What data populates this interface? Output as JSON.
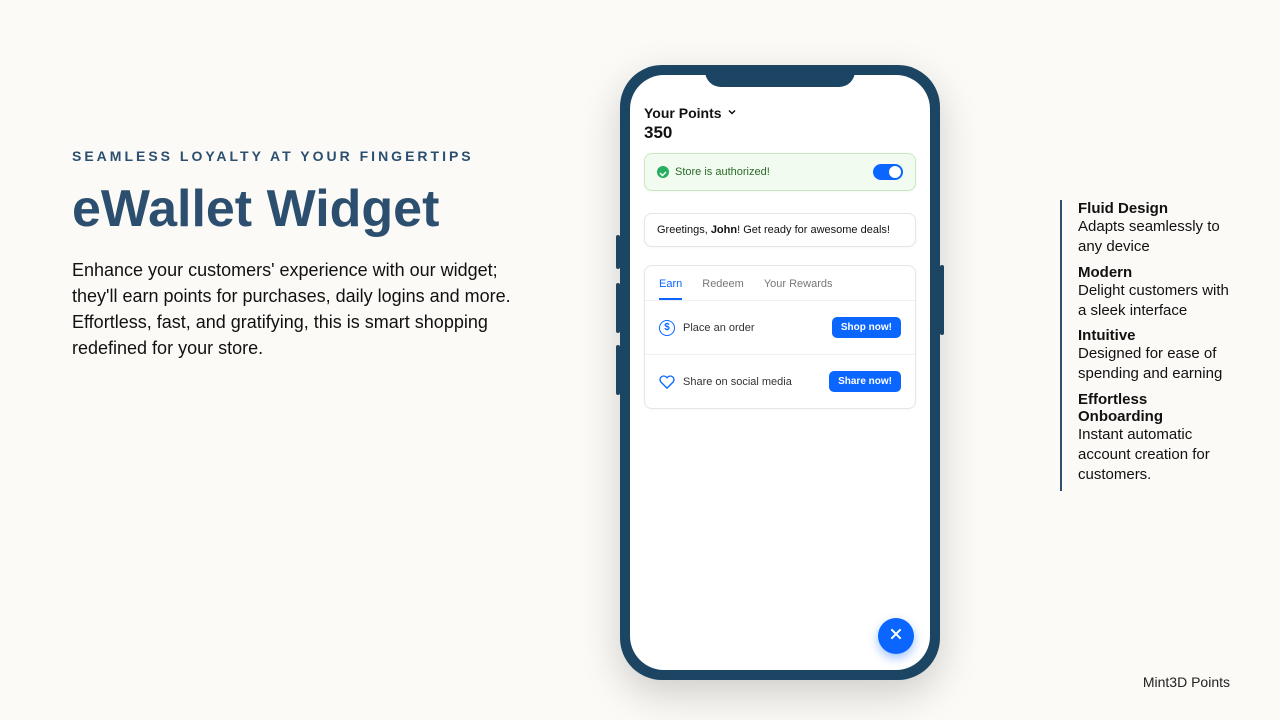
{
  "left": {
    "eyebrow": "SEAMLESS LOYALTY AT YOUR FINGERTIPS",
    "title": "eWallet Widget",
    "desc": "Enhance your customers' experience with our widget; they'll earn points for purchases, daily logins and more. Effortless, fast, and gratifying, this is smart shopping redefined for your store."
  },
  "features": [
    {
      "title": "Fluid Design",
      "desc": "Adapts seamlessly to any device"
    },
    {
      "title": "Modern",
      "desc": "Delight customers with a sleek interface"
    },
    {
      "title": "Intuitive",
      "desc": "Designed for ease of spending and earning"
    },
    {
      "title": "Effortless Onboarding",
      "desc": "Instant automatic account creation for customers."
    }
  ],
  "brand": "Mint3D Points",
  "phone": {
    "points_label": "Your Points",
    "points_value": "350",
    "auth_text": "Store is authorized!",
    "greeting_pre": "Greetings, ",
    "greeting_name": "John",
    "greeting_post": "! Get ready for awesome deals!",
    "tabs": {
      "earn": "Earn",
      "redeem": "Redeem",
      "rewards": "Your Rewards"
    },
    "actions": {
      "order_label": "Place an order",
      "order_btn": "Shop now!",
      "share_label": "Share on social media",
      "share_btn": "Share now!"
    }
  },
  "colors": {
    "brand_blue": "#2c4f70",
    "accent_blue": "#0a66ff",
    "success": "#27ae60"
  }
}
